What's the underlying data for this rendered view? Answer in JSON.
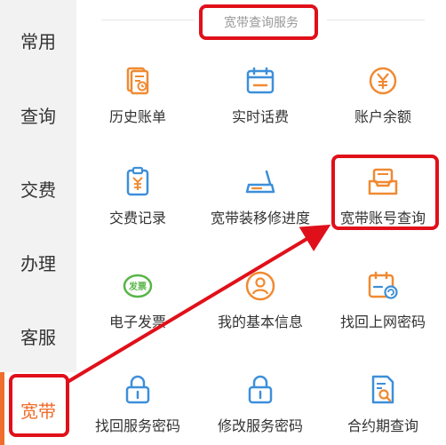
{
  "sidebar": {
    "items": [
      {
        "label": "常用"
      },
      {
        "label": "查询"
      },
      {
        "label": "交费"
      },
      {
        "label": "办理"
      },
      {
        "label": "客服"
      },
      {
        "label": "宽带"
      }
    ],
    "active_index": 5
  },
  "section": {
    "title": "宽带查询服务"
  },
  "grid": {
    "items": [
      {
        "label": "历史账单",
        "icon": "bill-history-icon"
      },
      {
        "label": "实时话费",
        "icon": "calendar-icon"
      },
      {
        "label": "账户余额",
        "icon": "yuan-coin-icon"
      },
      {
        "label": "交费记录",
        "icon": "payment-record-icon"
      },
      {
        "label": "宽带装移修进度",
        "icon": "router-icon"
      },
      {
        "label": "宽带账号查询",
        "icon": "inbox-icon"
      },
      {
        "label": "电子发票",
        "icon": "invoice-icon",
        "icon_text": "发票"
      },
      {
        "label": "我的基本信息",
        "icon": "user-info-icon"
      },
      {
        "label": "找回上网密码",
        "icon": "calendar-refresh-icon"
      },
      {
        "label": "找回服务密码",
        "icon": "lock-icon"
      },
      {
        "label": "修改服务密码",
        "icon": "lock-icon"
      },
      {
        "label": "合约期查询",
        "icon": "document-search-icon"
      }
    ]
  },
  "colors": {
    "accent": "#ef6d2d",
    "icon_orange": "#f08a32",
    "icon_blue": "#3d8fd9",
    "icon_green": "#58b548",
    "highlight_red": "#e0101a"
  }
}
